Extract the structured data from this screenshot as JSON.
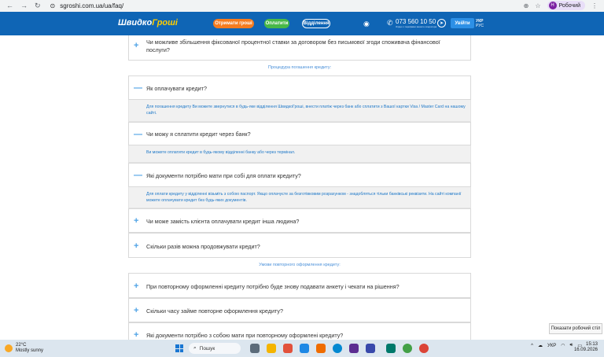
{
  "browser": {
    "url": "sgroshi.com.ua/ua/faq/",
    "profile_initial": "Н",
    "profile_name": "Робочий"
  },
  "header": {
    "logo_part1": "Швидко",
    "logo_part2": "Гроші",
    "btn_get": "Отримати гроші",
    "btn_pay": "Оплатити",
    "btn_branches": "Відділення",
    "phone": "073 560 10 50",
    "phone_note": "Згідно з тарифами вашого оператора",
    "login": "Увійти",
    "lang_ua": "УКР",
    "lang_ru": "РУС"
  },
  "faq": {
    "top_question": "Чи можливе збільшення фіксованої процентної ставки за договором без письмової згоди споживача фінансової послуги?",
    "section_repayment": "Процедура погашення кредиту:",
    "items": [
      {
        "q": "Як оплачувати кредит?",
        "a": "Для погашення кредиту Ви можете звернутися в будь-яке відділення ШвидкоГроші, внести платіж через банк або сплатити з Вашої картки Visa / Master Card на нашому сайті."
      },
      {
        "q": "Чи можу я сплатити кредит через банк?",
        "a": "Ви можете оплатити кредит в будь-якому відділенні банку або через термінал."
      },
      {
        "q": "Які документи потрібно мати при собі для оплати кредиту?",
        "a": "Для оплати кредиту у відділенні візьміть з собою паспорт. Якщо оплачуєте за безготівковим розрахунком - знадобляться тільки банківські реквізити. На сайті компанії можете оплачувати кредит без будь-яких документів."
      },
      {
        "q": "Чи може замість клієнта оплачувати кредит інша людина?"
      },
      {
        "q": "Скільки разів можна продовжувати кредит?"
      }
    ],
    "section_repeat": "Умови повторного оформлення кредиту:",
    "repeat_items": [
      {
        "q": "При повторному оформленні кредиту потрібно буде знову подавати анкету і чекати на рішення?"
      },
      {
        "q": "Скільки часу займе повторне оформлення кредиту?"
      },
      {
        "q": "Які документи потрібно з собою мати при повторному оформлені кредиту?"
      }
    ]
  },
  "tooltip": "Показати робочий стіл",
  "taskbar": {
    "temp": "22°C",
    "weather": "Mostly sunny",
    "search": "Пошук",
    "lang": "УКР",
    "time": "15:13",
    "date": "16.09.2026"
  }
}
